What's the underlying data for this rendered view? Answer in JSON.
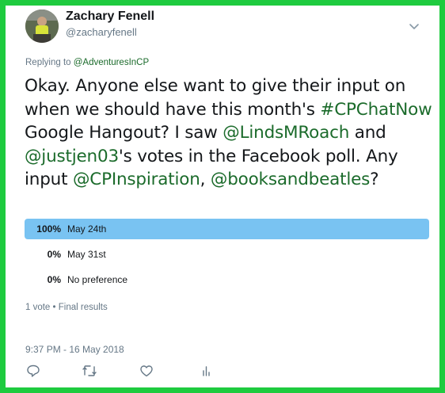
{
  "user": {
    "display_name": "Zachary Fenell",
    "handle": "@zacharyfenell"
  },
  "reply": {
    "prefix": "Replying to ",
    "target": "@AdventuresInCP"
  },
  "tweet": {
    "parts": [
      {
        "text": "Okay. Anyone else want to give their input on when we should have this month's ",
        "link": false
      },
      {
        "text": "#CPChatNow",
        "link": true
      },
      {
        "text": " Google Hangout? I saw ",
        "link": false
      },
      {
        "text": "@LindsMRoach",
        "link": true
      },
      {
        "text": " and ",
        "link": false
      },
      {
        "text": "@justjen03",
        "link": true
      },
      {
        "text": "'s votes in the Facebook poll. Any input ",
        "link": false
      },
      {
        "text": "@CPInspiration",
        "link": true
      },
      {
        "text": ", ",
        "link": false
      },
      {
        "text": "@booksandbeatles",
        "link": true
      },
      {
        "text": "?",
        "link": false
      }
    ]
  },
  "poll": {
    "options": [
      {
        "percent_label": "100%",
        "percent": 100,
        "choice": "May 24th",
        "winner": true
      },
      {
        "percent_label": "0%",
        "percent": 0,
        "choice": "May 31st",
        "winner": false
      },
      {
        "percent_label": "0%",
        "percent": 0,
        "choice": "No preference",
        "winner": false
      }
    ],
    "meta": "1 vote • Final results"
  },
  "timestamp": "9:37 PM - 16 May 2018",
  "icons": {
    "caret": "chevron-down-icon",
    "reply": "reply-icon",
    "retweet": "retweet-icon",
    "like": "heart-icon",
    "analytics": "analytics-icon"
  },
  "colors": {
    "frame": "#1ecb3f",
    "link": "#1b6b2b",
    "poll_bar": "#79c3f2",
    "meta": "#657786"
  }
}
